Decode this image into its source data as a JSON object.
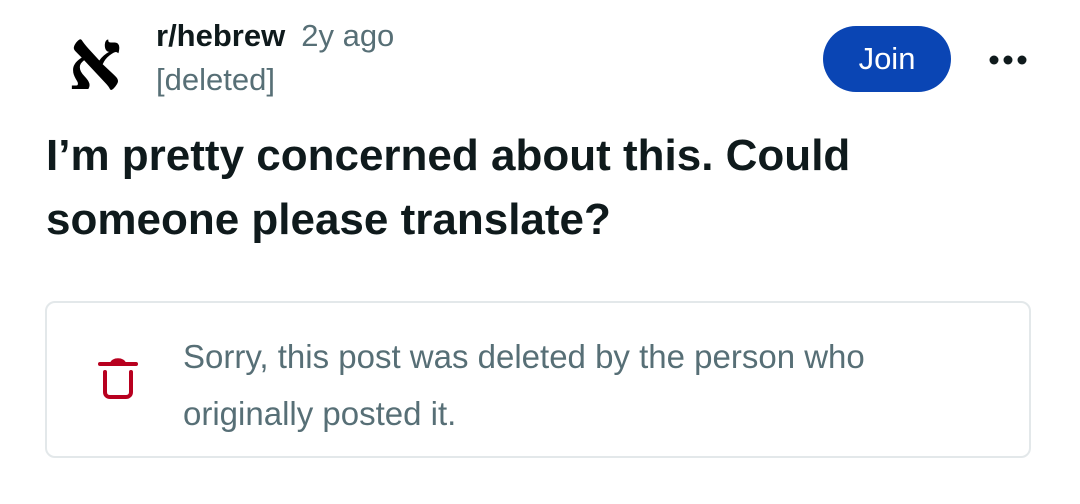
{
  "post": {
    "community": {
      "name": "r/hebrew",
      "avatar_glyph": "א",
      "avatar_icon": "aleph-icon"
    },
    "age": "2y ago",
    "author": "[deleted]",
    "title": "I’m pretty concerned about this. Could someone please translate?",
    "actions": {
      "join_label": "Join",
      "more_icon": "more-horizontal-icon"
    },
    "deleted_notice": {
      "icon": "trash-icon",
      "message": "Sorry, this post was deleted by the person who originally posted it."
    }
  },
  "colors": {
    "join_button": "#0a45b4",
    "deleted_icon": "#b8001f",
    "muted_text": "#576f76",
    "primary_text": "#0f1a1c",
    "card_border": "#e3e8ea"
  }
}
